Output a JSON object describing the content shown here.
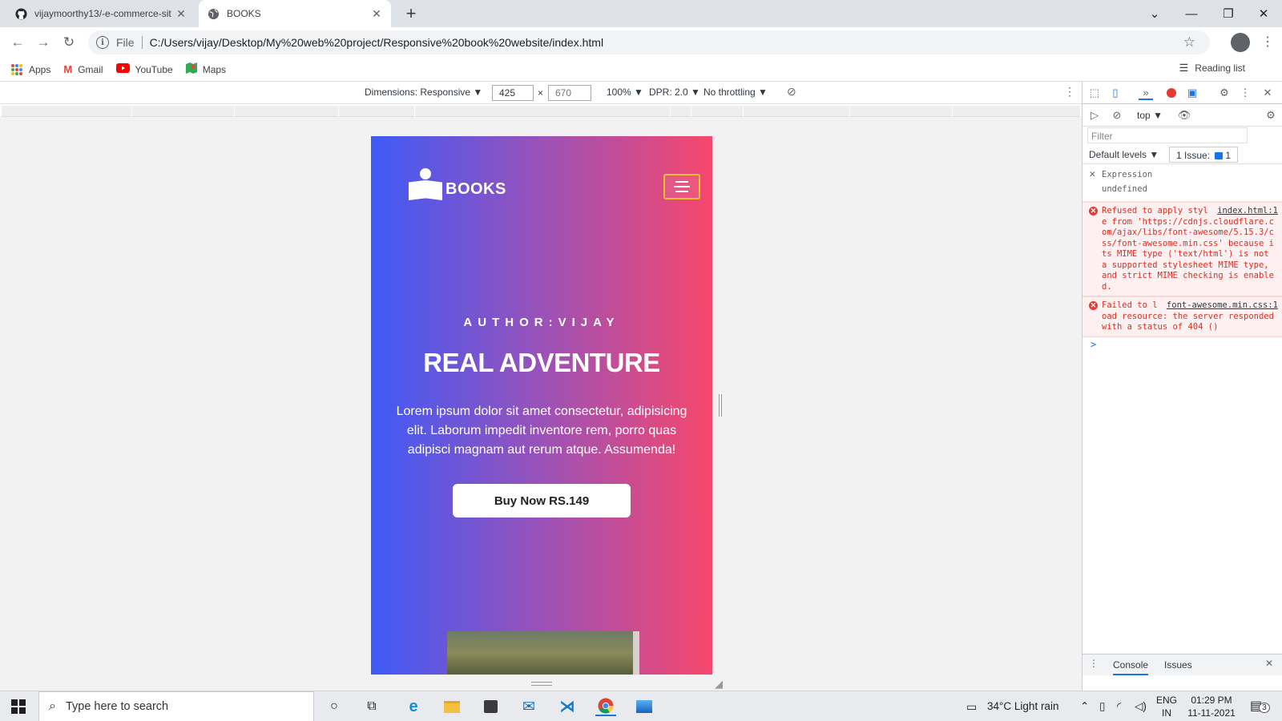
{
  "browser": {
    "tabs": [
      {
        "title": "vijaymoorthy13/-e-commerce-sit",
        "icon": "github-icon",
        "active": false
      },
      {
        "title": "BOOKS",
        "icon": "globe-icon",
        "active": true
      }
    ],
    "new_tab": "+",
    "window_controls": {
      "menu": "⌄",
      "minimize": "—",
      "restore": "❐",
      "close": "✕"
    },
    "omnibox": {
      "scheme": "File",
      "url": "C:/Users/vijay/Desktop/My%20web%20project/Responsive%20book%20website/index.html"
    },
    "bookmarks": [
      {
        "label": "Apps",
        "icon": "apps-grid-icon"
      },
      {
        "label": "Gmail",
        "icon": "gmail-icon"
      },
      {
        "label": "YouTube",
        "icon": "youtube-icon"
      },
      {
        "label": "Maps",
        "icon": "maps-icon"
      }
    ],
    "reading_list": "Reading list"
  },
  "device_toolbar": {
    "dimensions": "Dimensions: Responsive ▼",
    "width": "425",
    "times": "×",
    "height": "670",
    "zoom": "100% ▼",
    "dpr": "DPR: 2.0 ▼",
    "throttling": "No throttling ▼"
  },
  "page": {
    "logo_text": "BOOKS",
    "author": "AUTHOR:VIJAY",
    "title": "REAL ADVENTURE",
    "description": "Lorem ipsum dolor sit amet consectetur, adipisicing elit. Laborum impedit inventore rem, porro quas adipisci magnam aut rerum atque. Assumenda!",
    "button": "Buy Now RS.149",
    "colors": {
      "gradient_start": "#3e5af6",
      "gradient_mid": "#9a52b8",
      "gradient_end": "#f7476c",
      "menu_border": "#f7c02f"
    }
  },
  "devtools": {
    "context": "top ▼",
    "filter_placeholder": "Filter",
    "levels": "Default levels ▼",
    "issues": "1 Issue:",
    "issues_count": "1",
    "expression_label": "Expression",
    "expression_value": "undefined",
    "errors": [
      {
        "message": "Refused to apply style from 'https://cdnjs.cloudflare.com/ajax/libs/font-awesome/5.15.3/css/font-awesome.min.css' because its MIME type ('text/html') is not a supported stylesheet MIME type, and strict MIME checking is enabled.",
        "source": "index.html:1"
      },
      {
        "message": "Failed to load resource: the server responded with a status of 404 ()",
        "source": "font-awesome.min.css:1"
      }
    ],
    "prompt": ">",
    "drawer_tabs": [
      "Console",
      "Issues"
    ]
  },
  "taskbar": {
    "search_placeholder": "Type here to search",
    "weather": "34°C  Light rain",
    "language": "ENG",
    "region": "IN",
    "time": "01:29 PM",
    "date": "11-11-2021",
    "notifications": "3"
  }
}
